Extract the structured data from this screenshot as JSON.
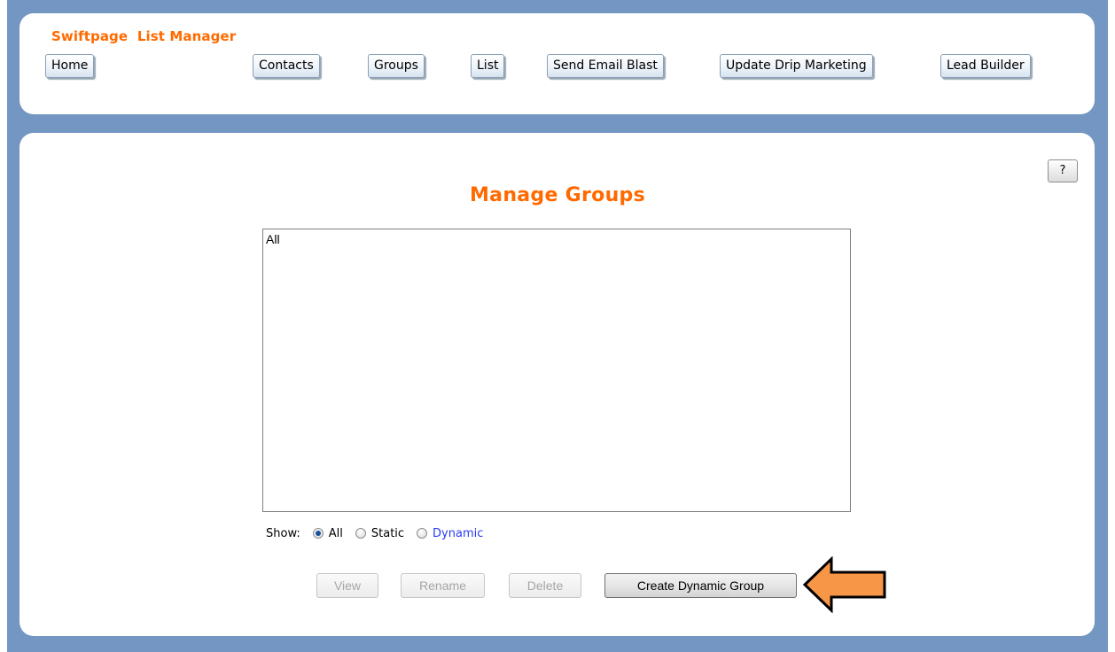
{
  "header": {
    "brand": "Swiftpage  List Manager",
    "nav": [
      {
        "label": "Home"
      },
      {
        "label": "Contacts"
      },
      {
        "label": "Groups"
      },
      {
        "label": "List"
      },
      {
        "label": "Send Email Blast"
      },
      {
        "label": "Update Drip Marketing"
      },
      {
        "label": "Lead Builder"
      }
    ]
  },
  "help": {
    "label": "?"
  },
  "main": {
    "title": "Manage Groups",
    "group_list": {
      "items": [
        "All"
      ]
    },
    "show_filter": {
      "label": "Show:",
      "options": [
        {
          "label": "All",
          "checked": true
        },
        {
          "label": "Static",
          "checked": false
        },
        {
          "label": "Dynamic",
          "checked": false
        }
      ]
    },
    "actions": {
      "view": "View",
      "rename": "Rename",
      "delete": "Delete",
      "create_dynamic": "Create Dynamic Group"
    }
  },
  "colors": {
    "frame": "#7396c3",
    "brand_orange": "#ff6a00",
    "callout_arrow": "#f79646"
  },
  "icons": {
    "callout": "left-arrow-icon"
  }
}
